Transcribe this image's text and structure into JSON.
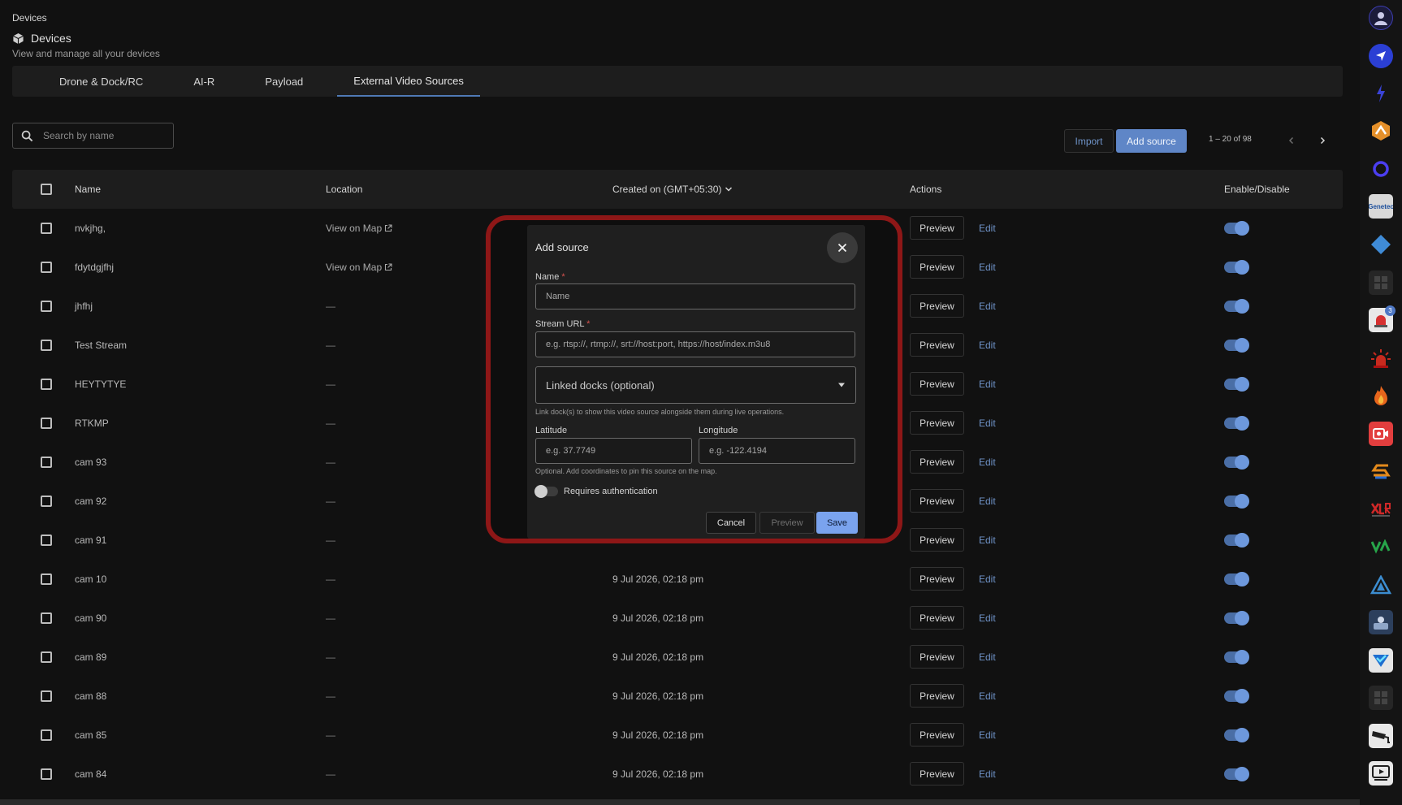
{
  "header": {
    "breadcrumb": "Devices",
    "title": "Devices",
    "subtitle": "View and manage all your devices"
  },
  "tabs": [
    {
      "label": "Drone & Dock/RC",
      "active": false
    },
    {
      "label": "AI-R",
      "active": false
    },
    {
      "label": "Payload",
      "active": false
    },
    {
      "label": "External Video Sources",
      "active": true
    }
  ],
  "toolbar": {
    "search_placeholder": "Search by name",
    "import_label": "Import",
    "add_label": "Add source",
    "pagination": "1 – 20 of 98"
  },
  "table": {
    "columns": {
      "name": "Name",
      "location": "Location",
      "created": "Created on (GMT+05:30)",
      "actions": "Actions",
      "enable": "Enable/Disable"
    },
    "preview_label": "Preview",
    "edit_label": "Edit",
    "rows": [
      {
        "name": "nvkjhg,",
        "location": "View on Map",
        "created": "",
        "enabled": true
      },
      {
        "name": "fdytdgjfhj",
        "location": "View on Map",
        "created": "",
        "enabled": true
      },
      {
        "name": "jhfhj",
        "location": "—",
        "created": "",
        "enabled": true
      },
      {
        "name": "Test Stream",
        "location": "—",
        "created": "",
        "enabled": true
      },
      {
        "name": "HEYTYTYE",
        "location": "—",
        "created": "",
        "enabled": true
      },
      {
        "name": "RTKMP",
        "location": "—",
        "created": "",
        "enabled": true
      },
      {
        "name": "cam 93",
        "location": "—",
        "created": "",
        "enabled": true
      },
      {
        "name": "cam 92",
        "location": "—",
        "created": "",
        "enabled": true
      },
      {
        "name": "cam 91",
        "location": "—",
        "created": "",
        "enabled": true
      },
      {
        "name": "cam 10",
        "location": "—",
        "created": "9 Jul 2026, 02:18 pm",
        "enabled": true
      },
      {
        "name": "cam 90",
        "location": "—",
        "created": "9 Jul 2026, 02:18 pm",
        "enabled": true
      },
      {
        "name": "cam 89",
        "location": "—",
        "created": "9 Jul 2026, 02:18 pm",
        "enabled": true
      },
      {
        "name": "cam 88",
        "location": "—",
        "created": "9 Jul 2026, 02:18 pm",
        "enabled": true
      },
      {
        "name": "cam 85",
        "location": "—",
        "created": "9 Jul 2026, 02:18 pm",
        "enabled": true
      },
      {
        "name": "cam 84",
        "location": "—",
        "created": "9 Jul 2026, 02:18 pm",
        "enabled": true
      }
    ]
  },
  "modal": {
    "title": "Add source",
    "name_label": "Name",
    "name_placeholder": "Name",
    "url_label": "Stream URL",
    "url_placeholder": "e.g. rtsp://, rtmp://, srt://host:port, https://host/index.m3u8",
    "docks_label": "Linked docks (optional)",
    "docks_help": "Link dock(s) to show this video source alongside them during live operations.",
    "latitude_label": "Latitude",
    "latitude_placeholder": "e.g. 37.7749",
    "longitude_label": "Longitude",
    "longitude_placeholder": "e.g. -122.4194",
    "coords_help": "Optional. Add coordinates to pin this source on the map.",
    "auth_label": "Requires authentication",
    "auth_enabled": false,
    "cancel_label": "Cancel",
    "preview_label": "Preview",
    "save_label": "Save"
  },
  "rail": {
    "apps": [
      "profile-avatar",
      "send-app",
      "bolt-app",
      "orange-app",
      "ring-app",
      "genetec-app",
      "diamond-app",
      "grid-app",
      "alert-app",
      "siren-app",
      "fire-app",
      "camera-app",
      "s-app",
      "xlr-app",
      "va-app",
      "delta-app",
      "sensor-app",
      "check-app",
      "grid-app-2",
      "cctv-app",
      "video-app"
    ],
    "alert_badge": "3",
    "genetec_text": "Genetec"
  },
  "colors": {
    "accent": "#5f86c7",
    "link": "#6f93c8",
    "highlight": "#8e1717",
    "save": "#7aa3ee"
  }
}
